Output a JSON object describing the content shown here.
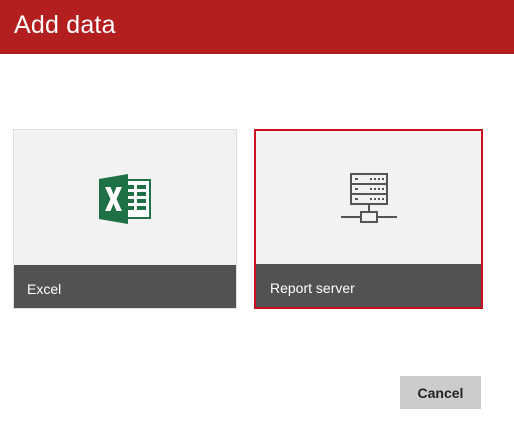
{
  "dialog": {
    "title": "Add data"
  },
  "tiles": [
    {
      "label": "Excel",
      "icon": "excel-icon",
      "selected": false
    },
    {
      "label": "Report server",
      "icon": "report-server-icon",
      "selected": true
    }
  ],
  "footer": {
    "cancel_label": "Cancel"
  },
  "colors": {
    "header": "#b31e1e",
    "selection_border": "#c8101e",
    "tile_background": "#f2f2f2",
    "tile_footer": "#525252",
    "excel_green": "#1e7145",
    "button": "#cccccc"
  }
}
